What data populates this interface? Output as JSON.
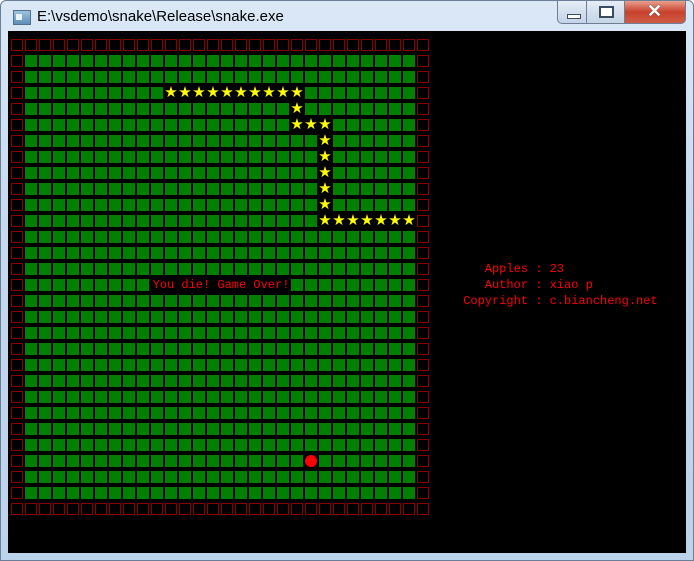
{
  "window": {
    "title": "E:\\vsdemo\\snake\\Release\\snake.exe",
    "icon": "console-app-icon"
  },
  "controls": {
    "minimize": "minimize-icon",
    "maximize": "maximize-icon",
    "close": "close-icon"
  },
  "game": {
    "grid_columns": 30,
    "grid_rows": 30,
    "colors": {
      "wall": "#8b0000",
      "grass": "#008000",
      "snake": "#ffff00",
      "apple": "#ff0000",
      "text": "#ff0000"
    },
    "snake": [
      [
        11,
        3
      ],
      [
        12,
        3
      ],
      [
        13,
        3
      ],
      [
        14,
        3
      ],
      [
        15,
        3
      ],
      [
        16,
        3
      ],
      [
        17,
        3
      ],
      [
        18,
        3
      ],
      [
        19,
        3
      ],
      [
        20,
        3
      ],
      [
        20,
        4
      ],
      [
        20,
        5
      ],
      [
        21,
        5
      ],
      [
        22,
        5
      ],
      [
        22,
        6
      ],
      [
        22,
        7
      ],
      [
        22,
        8
      ],
      [
        22,
        9
      ],
      [
        22,
        10
      ],
      [
        22,
        11
      ],
      [
        23,
        11
      ],
      [
        24,
        11
      ],
      [
        25,
        11
      ],
      [
        26,
        11
      ],
      [
        27,
        11
      ],
      [
        28,
        11
      ]
    ],
    "apple": [
      21,
      26
    ],
    "message": "You die! Game Over!"
  },
  "info": [
    {
      "label": "Apples",
      "sep": " : ",
      "value": "23"
    },
    {
      "label": "Author",
      "sep": " : ",
      "value": "xiao p"
    },
    {
      "label": "Copyright",
      "sep": " : ",
      "value": "c.biancheng.net"
    }
  ]
}
